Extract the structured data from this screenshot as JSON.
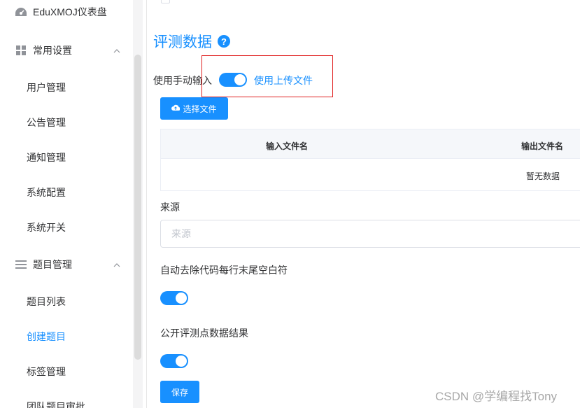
{
  "sidebar": {
    "dashboard_label": "EduXMOJ仪表盘",
    "settings_group_label": "常用设置",
    "settings_items": [
      "用户管理",
      "公告管理",
      "通知管理",
      "系统配置",
      "系统开关"
    ],
    "problem_group_label": "题目管理",
    "problem_items": [
      "题目列表",
      "创建题目",
      "标签管理",
      "团队题目审批"
    ],
    "active_item": "创建题目"
  },
  "main": {
    "section_title": "评测数据",
    "help_icon": "?",
    "manual_input_label": "使用手动输入",
    "upload_file_label": "使用上传文件",
    "choose_file_button": "选择文件",
    "table": {
      "columns": [
        "输入文件名",
        "输出文件名"
      ],
      "empty_text": "暂无数据"
    },
    "source_label": "来源",
    "source_placeholder": "来源",
    "trim_label": "自动去除代码每行末尾空白符",
    "public_label": "公开评测点数据结果",
    "save_button": "保存"
  },
  "watermark": "CSDN @学编程找Tony",
  "colors": {
    "accent": "#1890ff",
    "highlight_box": "#e02020"
  }
}
